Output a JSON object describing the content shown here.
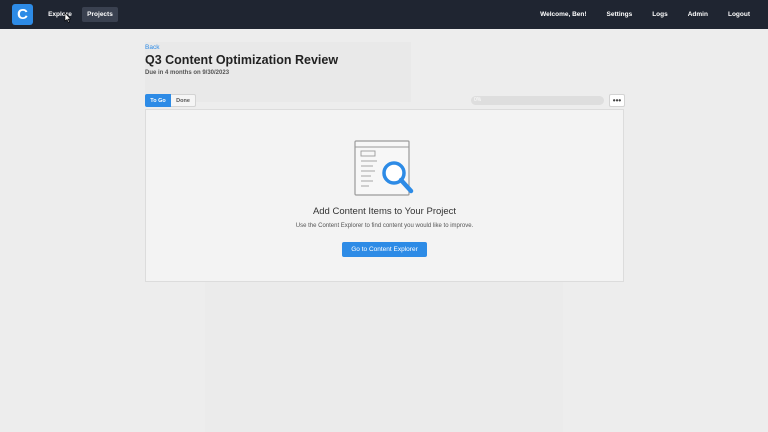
{
  "app": {
    "logo_letter": "C"
  },
  "nav": {
    "explore_label": "Explore",
    "projects_label": "Projects",
    "welcome": "Welcome, Ben!",
    "settings": "Settings",
    "logs": "Logs",
    "admin": "Admin",
    "logout": "Logout"
  },
  "project": {
    "back_label": "Back",
    "title": "Q3 Content Optimization Review",
    "due": "Due in 4 months on 9/30/2023"
  },
  "tabs": [
    {
      "label": "To Go",
      "active": true
    },
    {
      "label": "Done",
      "active": false
    }
  ],
  "progress": {
    "value_percent": 0,
    "label": "0%"
  },
  "more_label": "•••",
  "empty_state": {
    "title": "Add Content Items to Your Project",
    "description": "Use the Content Explorer to find content you would like to improve.",
    "cta_label": "Go to Content Explorer"
  },
  "colors": {
    "accent": "#2d8be6",
    "topbar": "#1f2531"
  }
}
